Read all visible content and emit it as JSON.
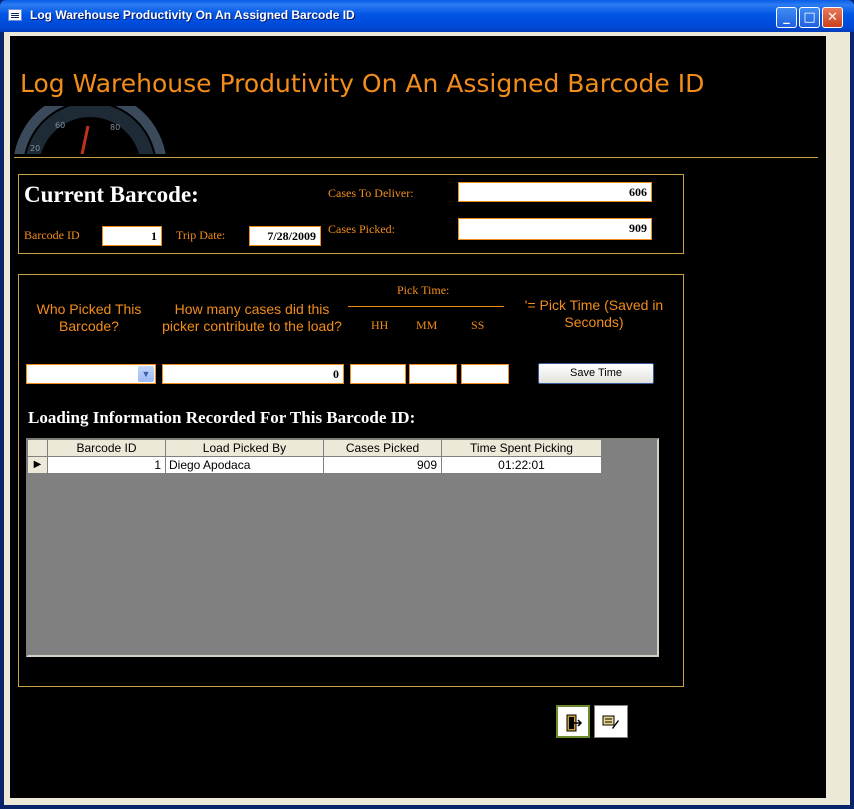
{
  "window": {
    "title": "Log Warehouse Productivity On An Assigned Barcode ID",
    "min_glyph": "_",
    "max_glyph": "□",
    "close_glyph": "✕"
  },
  "header": {
    "title": "Log Warehouse Produtivity On An Assigned Barcode ID"
  },
  "current": {
    "heading": "Current Barcode:",
    "barcode_id_label": "Barcode ID",
    "barcode_id_value": "1",
    "trip_date_label": "Trip Date:",
    "trip_date_value": "7/28/2009",
    "cases_to_deliver_label": "Cases To Deliver:",
    "cases_to_deliver_value": "606",
    "cases_picked_label": "Cases Picked:",
    "cases_picked_value": "909"
  },
  "entry": {
    "who_picked_label": "Who Picked This Barcode?",
    "how_many_label": "How many cases did this picker contribute to the load?",
    "pick_time_label": "Pick Time:",
    "hh_label": "HH",
    "mm_label": "MM",
    "ss_label": "SS",
    "pick_time_note": "'= Pick Time (Saved in Seconds)",
    "cases_value": "0",
    "save_button": "Save Time"
  },
  "loading": {
    "title": "Loading Information Recorded For This Barcode ID:",
    "columns": [
      "Barcode ID",
      "Load Picked By",
      "Cases Picked",
      "Time Spent Picking"
    ],
    "rows": [
      {
        "barcode_id": "1",
        "picked_by": "Diego Apodaca",
        "cases": "909",
        "time": "01:22:01"
      }
    ],
    "record_selector_glyph": "▶"
  },
  "icons": {
    "exit": "exit-door-icon",
    "edit": "edit-record-icon",
    "combo": "chevron-down-icon"
  },
  "colors": {
    "accent": "#f28d1b",
    "border": "#c8a24a",
    "background": "#000000"
  }
}
